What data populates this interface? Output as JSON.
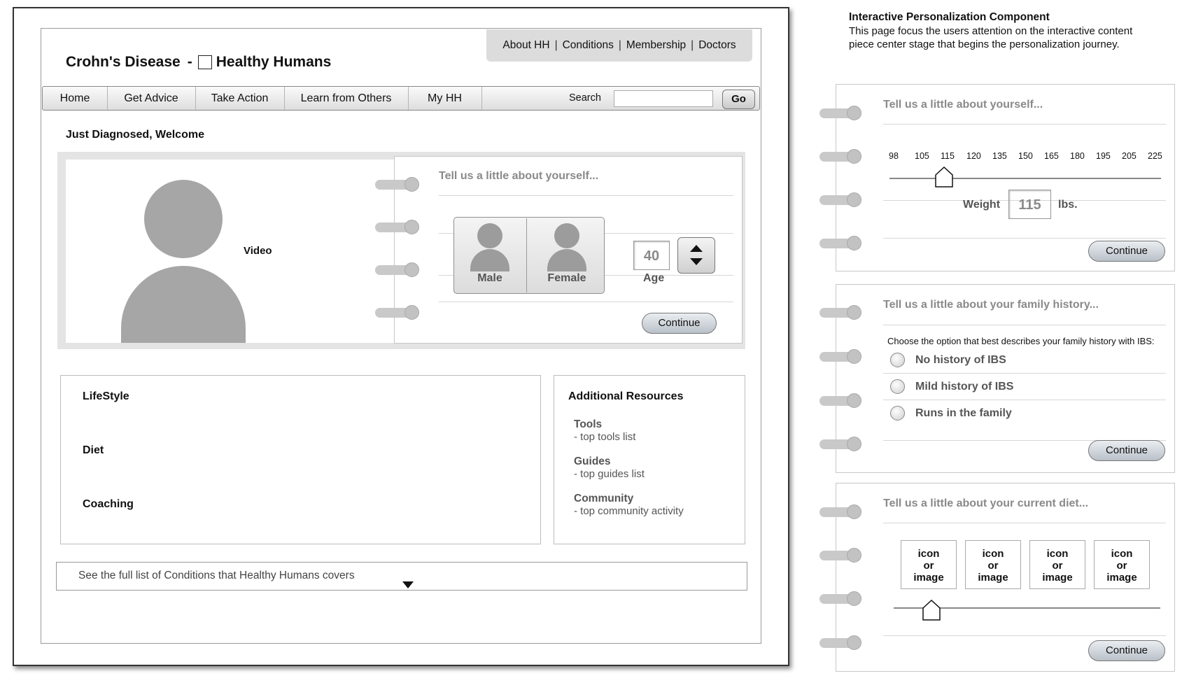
{
  "site": {
    "condition": "Crohn's Disease",
    "separator": "-",
    "brand": "Healthy Humans"
  },
  "top_nav": [
    "About HH",
    "Conditions",
    "Membership",
    "Doctors"
  ],
  "top_nav_sep": "|",
  "main_nav": [
    "Home",
    "Get Advice",
    "Take Action",
    "Learn from Others",
    "My HH"
  ],
  "search": {
    "label": "Search",
    "value": "",
    "go_label": "Go"
  },
  "welcome": "Just Diagnosed, Welcome",
  "video_label": "Video",
  "about_card": {
    "title": "Tell us a little about yourself...",
    "male_label": "Male",
    "female_label": "Female",
    "age_value": "40",
    "age_label": "Age",
    "continue_label": "Continue"
  },
  "sections": [
    "LifeStyle",
    "Diet",
    "Coaching"
  ],
  "resources": {
    "title": "Additional Resources",
    "items": [
      {
        "title": "Tools",
        "subtitle": "- top tools list"
      },
      {
        "title": "Guides",
        "subtitle": "- top guides list"
      },
      {
        "title": "Community",
        "subtitle": "- top community activity"
      }
    ]
  },
  "conditions_bar": "See the full list of Conditions that Healthy Humans covers",
  "annotation": {
    "title": "Interactive Personalization Component",
    "text": "This page focus the users attention on the interactive content piece center stage that begins the personalization journey."
  },
  "weight_card": {
    "title": "Tell us a little about yourself...",
    "scale": [
      "98",
      "105",
      "115",
      "120",
      "135",
      "150",
      "165",
      "180",
      "195",
      "205",
      "225"
    ],
    "selected_fraction": 0.2,
    "weight_label": "Weight",
    "weight_value": "115",
    "unit": "lbs.",
    "continue_label": "Continue"
  },
  "family_card": {
    "title": "Tell us a little about your family history...",
    "prompt": "Choose the option that best describes your family history with IBS:",
    "options": [
      "No history of IBS",
      "Mild history of IBS",
      "Runs in the family"
    ],
    "continue_label": "Continue"
  },
  "diet_card": {
    "title": "Tell us a little about your current diet...",
    "icons": [
      [
        "icon",
        "or",
        "image"
      ],
      [
        "icon",
        "or",
        "image"
      ],
      [
        "icon",
        "or",
        "image"
      ],
      [
        "icon",
        "or",
        "image"
      ]
    ],
    "selected_fraction": 0.13,
    "continue_label": "Continue"
  },
  "colors": {
    "button_top": "#eaeef2",
    "button_bottom": "#b9c0c8",
    "placeholder_gray": "#a6a6a6",
    "title_gray": "#8a8a8a"
  }
}
